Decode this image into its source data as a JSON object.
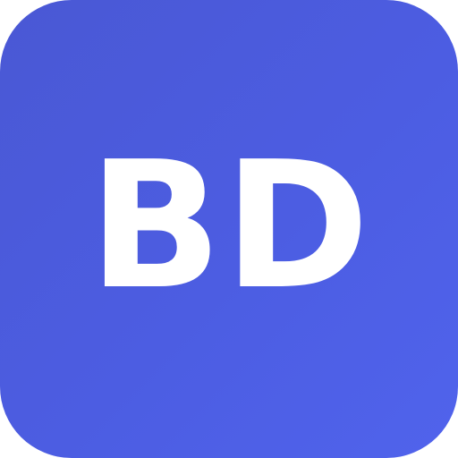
{
  "icon": {
    "monogram": "BD",
    "background_color": "#4c5de2",
    "text_color": "#ffffff"
  }
}
